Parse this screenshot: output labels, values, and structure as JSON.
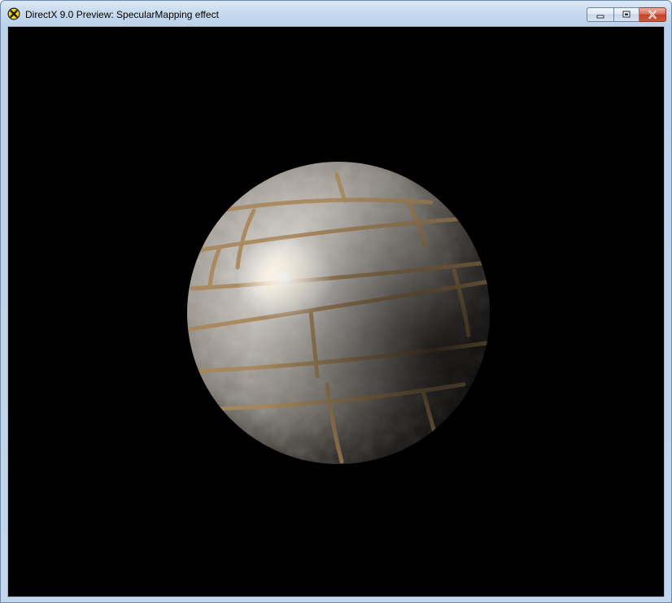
{
  "window": {
    "title": "DirectX 9.0 Preview: SpecularMapping effect",
    "icon": "directx-icon"
  },
  "caption_buttons": {
    "minimize": "minimize-icon",
    "maximize": "maximize-icon",
    "close": "close-icon"
  },
  "viewport": {
    "background": "#000000",
    "object": "brick-textured-sphere",
    "brick_color": "#b8b2aa",
    "mortar_color": "#a8875a",
    "highlight_color": "#ffffff"
  }
}
